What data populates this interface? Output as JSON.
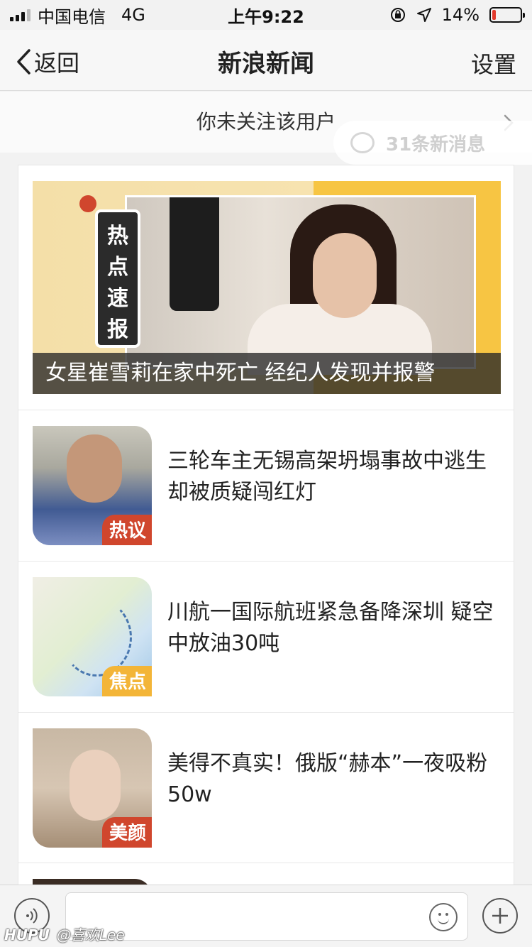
{
  "status_bar": {
    "carrier": "中国电信",
    "network": "4G",
    "time": "上午9:22",
    "battery": "14%",
    "battery_level": 0.14
  },
  "nav": {
    "back_label": "返回",
    "title": "新浪新闻",
    "settings_label": "设置"
  },
  "follow_banner": {
    "text": "你未关注该用户",
    "toast": "31条新消息"
  },
  "hero": {
    "tag_chars": [
      "热",
      "点",
      "速",
      "报"
    ],
    "caption": "女星崔雪莉在家中死亡 经纪人发现并报警"
  },
  "news_items": [
    {
      "badge": "热议",
      "title": "三轮车主无锡高架坍塌事故中逃生 却被质疑闯红灯"
    },
    {
      "badge": "焦点",
      "title": "川航一国际航班紧急备降深圳 疑空中放油30吨"
    },
    {
      "badge": "美颜",
      "title": "美得不真实！俄版“赫本”一夜吸粉50w"
    }
  ],
  "watermark": {
    "brand": "HUPU",
    "user": "@喜欢Lee"
  },
  "colors": {
    "accent_red": "#d0462d",
    "accent_yellow": "#f3b538",
    "battery_red": "#e23a2c"
  }
}
